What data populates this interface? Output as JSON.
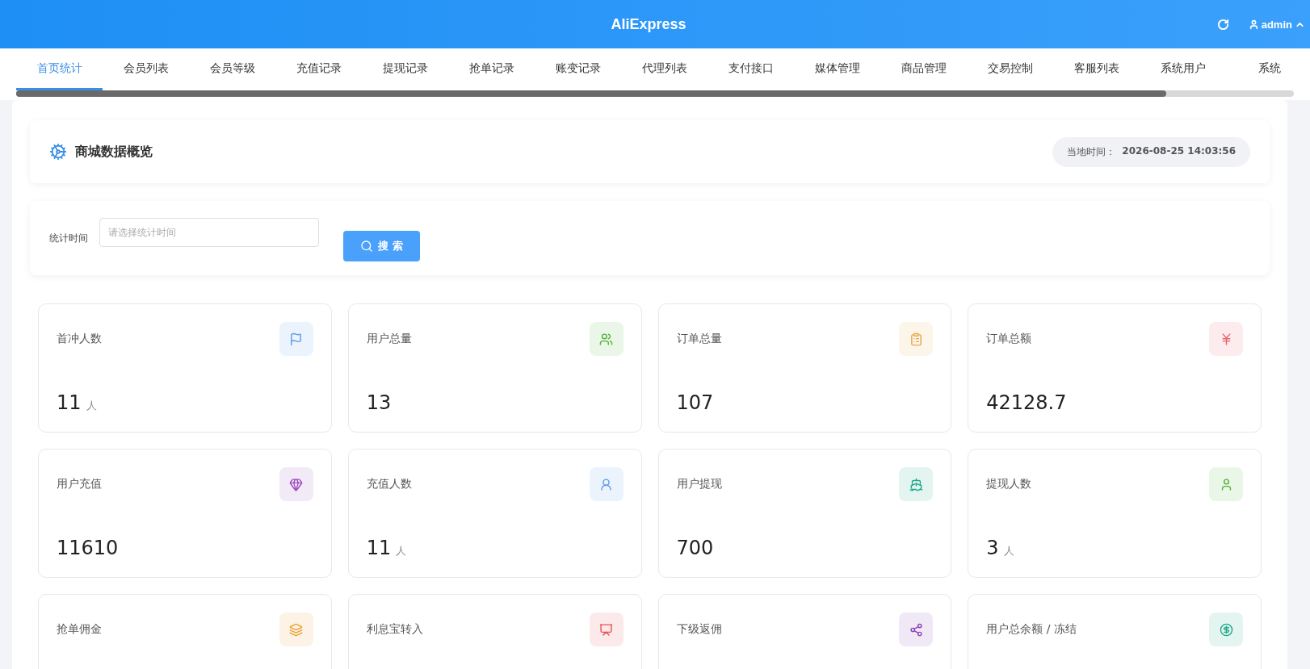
{
  "header": {
    "title": "AliExpress",
    "user": "admin"
  },
  "tabs": [
    {
      "label": "首页统计",
      "selected": true
    },
    {
      "label": "会员列表",
      "selected": false
    },
    {
      "label": "会员等级",
      "selected": false
    },
    {
      "label": "充值记录",
      "selected": false
    },
    {
      "label": "提现记录",
      "selected": false
    },
    {
      "label": "抢单记录",
      "selected": false
    },
    {
      "label": "账变记录",
      "selected": false
    },
    {
      "label": "代理列表",
      "selected": false
    },
    {
      "label": "支付接口",
      "selected": false
    },
    {
      "label": "媒体管理",
      "selected": false
    },
    {
      "label": "商品管理",
      "selected": false
    },
    {
      "label": "交易控制",
      "selected": false
    },
    {
      "label": "客服列表",
      "selected": false
    },
    {
      "label": "系统用户",
      "selected": false
    },
    {
      "label": "系统",
      "selected": false
    }
  ],
  "overview": {
    "title": "商城数据概览",
    "time_label": "当地时间：",
    "time": "2026-08-25 14:03:56"
  },
  "filter": {
    "label": "统计时间",
    "placeholder": "请选择统计时间",
    "button": "搜 索"
  },
  "cards": [
    {
      "label": "首冲人数",
      "value": "11",
      "unit": "人",
      "color": "#5b9bea"
    },
    {
      "label": "用户总量",
      "value": "13",
      "color": "#52b33c"
    },
    {
      "label": "订单总量",
      "value": "107",
      "color": "#e8a94a"
    },
    {
      "label": "订单总额",
      "value": "42128.7",
      "color": "#e8626a"
    },
    {
      "label": "用户充值",
      "value": "11610",
      "color": "#9b4fc0"
    },
    {
      "label": "充值人数",
      "value": "11",
      "unit": "人",
      "color": "#5b9bea"
    },
    {
      "label": "用户提现",
      "value": "700",
      "color": "#1fa88a"
    },
    {
      "label": "提现人数",
      "value": "3",
      "unit": "人",
      "color": "#52b33c"
    },
    {
      "label": "抢单佣金",
      "color": "#e8a030"
    },
    {
      "label": "利息宝转入",
      "color": "#e8505a"
    },
    {
      "label": "下级返佣",
      "color": "#8a45b8"
    },
    {
      "label": "用户总余额 / 冻结",
      "color": "#1fa88a"
    }
  ]
}
